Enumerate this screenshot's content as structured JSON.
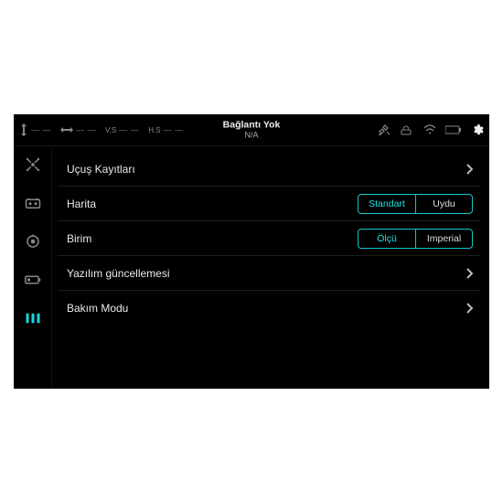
{
  "colors": {
    "accent": "#16d6e0"
  },
  "topbar": {
    "title": "Bağlantı Yok",
    "subtitle": "N/A",
    "dash": "— —"
  },
  "sidebar": {
    "items": [
      {
        "name": "drone"
      },
      {
        "name": "controller"
      },
      {
        "name": "gimbal"
      },
      {
        "name": "battery"
      },
      {
        "name": "general"
      }
    ],
    "activeIndex": 4
  },
  "settings": {
    "rows": [
      {
        "type": "link",
        "label": "Uçuş Kayıtları"
      },
      {
        "type": "segmented",
        "label": "Harita",
        "options": [
          "Standart",
          "Uydu"
        ],
        "selected": 0
      },
      {
        "type": "segmented",
        "label": "Birim",
        "options": [
          "Ölçü",
          "Imperial"
        ],
        "selected": 0
      },
      {
        "type": "link",
        "label": "Yazılım güncellemesi"
      },
      {
        "type": "link",
        "label": "Bakım Modu"
      }
    ]
  }
}
